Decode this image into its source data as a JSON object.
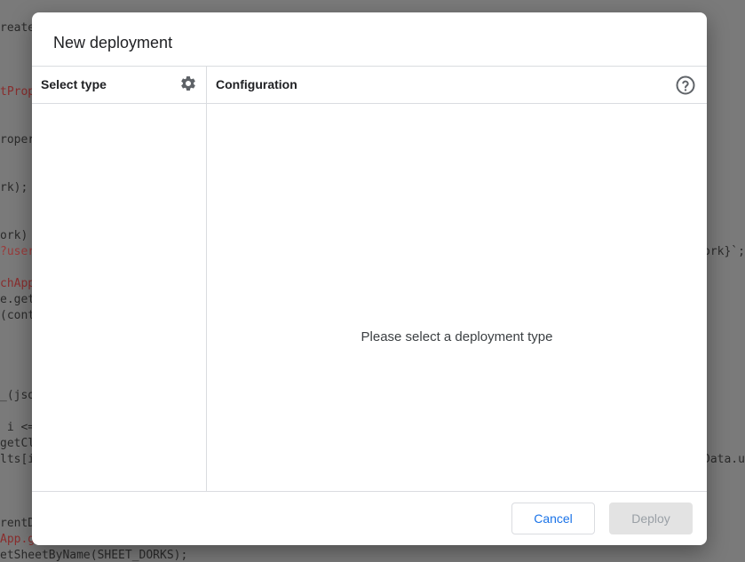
{
  "background_code": [
    {
      "text": "reate",
      "cls": ""
    },
    {
      "text": "tProp",
      "cls": "k"
    },
    {
      "text": "roper",
      "cls": ""
    },
    {
      "text": "rk);",
      "cls": ""
    },
    {
      "text": "ork)",
      "cls": ""
    },
    {
      "text": "?user",
      "cls": "k2"
    },
    {
      "text": "chApp",
      "cls": "k"
    },
    {
      "text": "e.get",
      "cls": ""
    },
    {
      "text": "(cont",
      "cls": ""
    },
    {
      "text": "_(jso",
      "cls": ""
    },
    {
      "text": " i <=",
      "cls": ""
    },
    {
      "text": "getCl",
      "cls": ""
    },
    {
      "text": "lts[i",
      "cls": ""
    },
    {
      "text": "rentD",
      "cls": ""
    },
    {
      "text": "App.g",
      "cls": "k"
    },
    {
      "text": "etSheetByName(SHEET_DORKS);",
      "cls": ""
    },
    {
      "text": "ork}`;",
      "cls": ""
    },
    {
      "text": "Data.u",
      "cls": ""
    }
  ],
  "dialog": {
    "title": "New deployment",
    "select_type_label": "Select type",
    "configuration_label": "Configuration",
    "empty_message": "Please select a deployment type",
    "cancel_label": "Cancel",
    "deploy_label": "Deploy",
    "colors": {
      "accent": "#1a73e8",
      "disabled_bg": "#e3e3e3",
      "disabled_text": "#9aa0a6"
    }
  }
}
